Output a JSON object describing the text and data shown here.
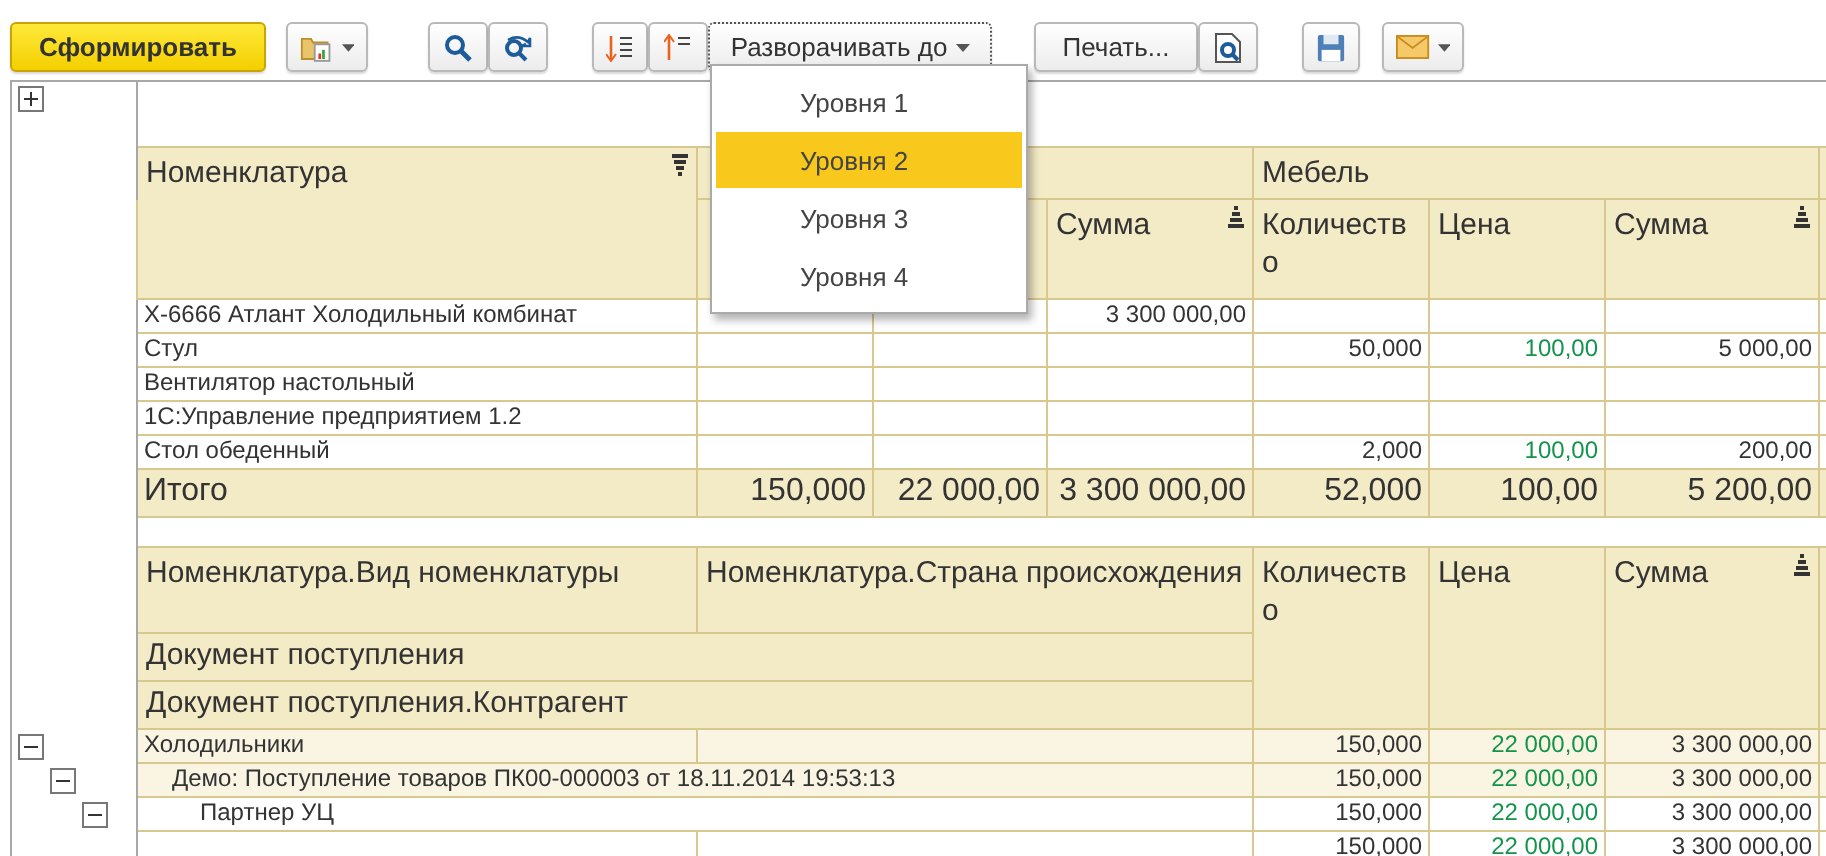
{
  "toolbar": {
    "generate_label": "Сформировать",
    "expand_label": "Разворачивать до",
    "print_label": "Печать..."
  },
  "expand_menu": [
    {
      "label": "Уровня 1",
      "selected": false
    },
    {
      "label": "Уровня 2",
      "selected": true
    },
    {
      "label": "Уровня 3",
      "selected": false
    },
    {
      "label": "Уровня 4",
      "selected": false
    }
  ],
  "outline_toggle": {
    "expanded": false
  },
  "report_1": {
    "nomenclature_header": "Номенклатура",
    "group_1": {
      "sum_header": "Сумма"
    },
    "group_2": {
      "title": "Мебель",
      "qty_header": "Количество",
      "price_header": "Цена",
      "sum_header": "Сумма"
    },
    "rows": [
      {
        "name": "Х-6666 Атлант Холодильный комбинат",
        "g1": {
          "sum": "3 300 000,00"
        },
        "g2": {}
      },
      {
        "name": "Стул",
        "g1": {},
        "g2": {
          "qty": "50,000",
          "price": "100,00",
          "sum": "5 000,00"
        }
      },
      {
        "name": "Вентилятор настольный",
        "g1": {},
        "g2": {}
      },
      {
        "name": "1С:Управление предприятием 1.2",
        "g1": {},
        "g2": {}
      },
      {
        "name": "Стол обеденный",
        "g1": {},
        "g2": {
          "qty": "2,000",
          "price": "100,00",
          "sum": "200,00"
        }
      }
    ],
    "total": {
      "label": "Итого",
      "g1": {
        "qty": "150,000",
        "price": "22 000,00",
        "sum": "3 300 000,00"
      },
      "g2": {
        "qty": "52,000",
        "price": "100,00",
        "sum": "5 200,00"
      }
    }
  },
  "report_2": {
    "headers": {
      "kind": "Номенклатура.Вид номенклатуры",
      "country": "Номенклатура.Страна происхождения",
      "document": "Документ поступления",
      "counterparty": "Документ поступления.Контрагент",
      "qty": "Количество",
      "price": "Цена",
      "sum": "Сумма"
    },
    "rows": [
      {
        "name": "Холодильники",
        "qty": "150,000",
        "price": "22 000,00",
        "sum": "3 300 000,00",
        "expanded": true,
        "children": [
          {
            "name": "Демо: Поступление товаров ПК00-000003 от 18.11.2014 19:53:13",
            "qty": "150,000",
            "price": "22 000,00",
            "sum": "3 300 000,00",
            "expanded": true,
            "children": [
              {
                "name": "Партнер УЦ",
                "qty": "150,000",
                "price": "22 000,00",
                "sum": "3 300 000,00",
                "expanded": true,
                "children": [
                  {
                    "qty": "150,000",
                    "price": "22 000,00",
                    "sum": "3 300 000,00"
                  }
                ]
              }
            ]
          }
        ]
      }
    ]
  }
}
